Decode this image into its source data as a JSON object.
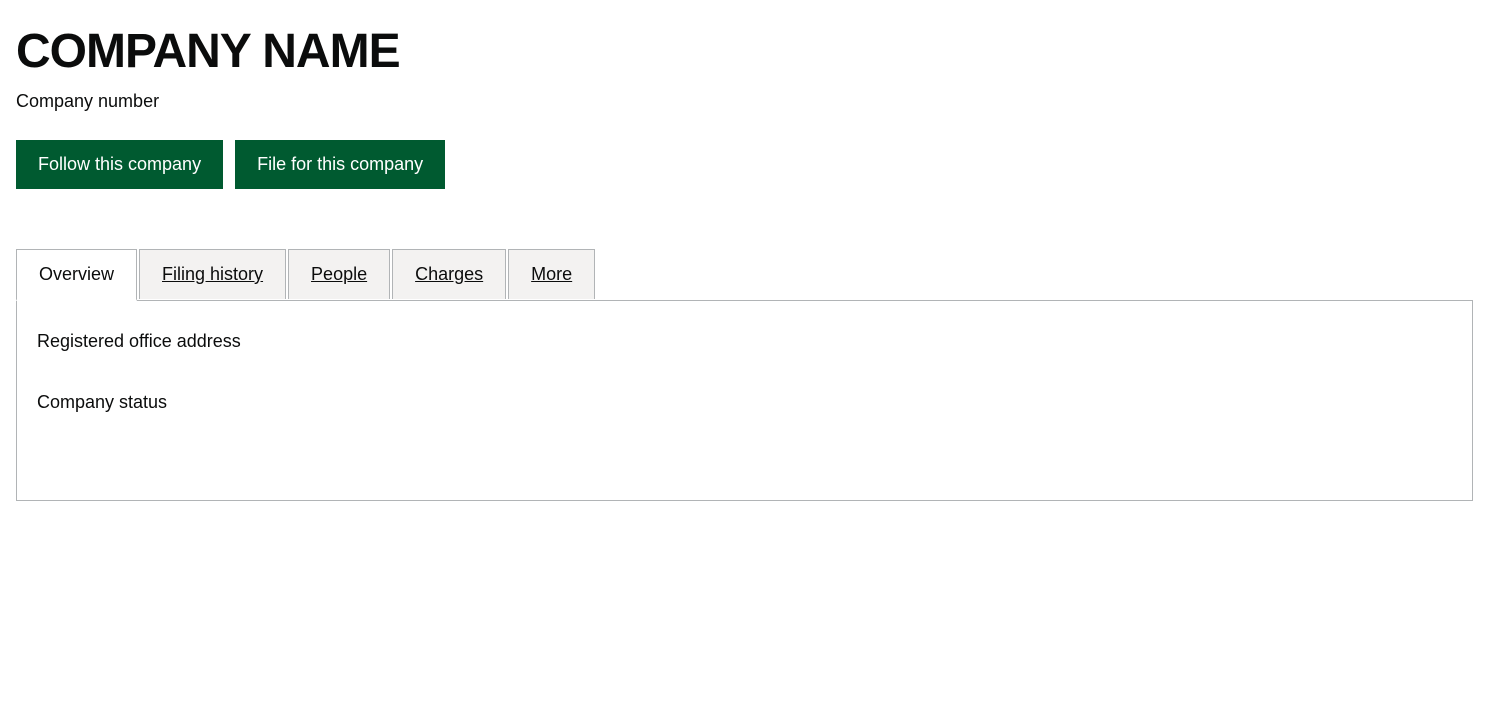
{
  "company": {
    "name": "COMPANY NAME",
    "number_label": "Company number"
  },
  "buttons": {
    "follow_label": "Follow this company",
    "file_label": "File for this company"
  },
  "tabs": [
    {
      "id": "overview",
      "label": "Overview",
      "active": true
    },
    {
      "id": "filing-history",
      "label": "Filing history",
      "active": false
    },
    {
      "id": "people",
      "label": "People",
      "active": false
    },
    {
      "id": "charges",
      "label": "Charges",
      "active": false
    },
    {
      "id": "more",
      "label": "More",
      "active": false
    }
  ],
  "overview": {
    "registered_office_label": "Registered office address",
    "company_status_label": "Company status"
  },
  "colors": {
    "green": "#005a30",
    "border": "#b1b4b6",
    "text": "#0b0c0c",
    "bg_tab_inactive": "#f3f2f1",
    "bg_tab_active": "#ffffff"
  }
}
